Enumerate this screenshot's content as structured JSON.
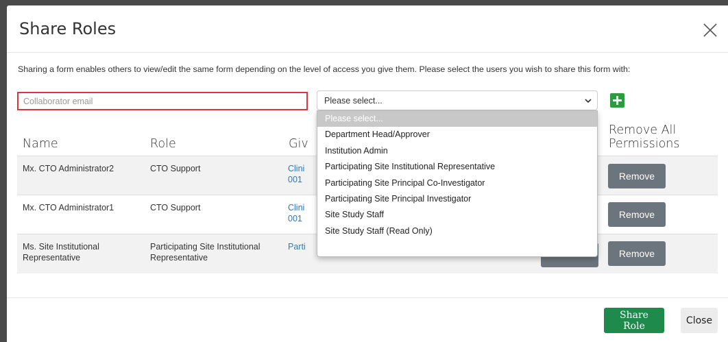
{
  "dialog": {
    "title": "Share Roles",
    "intro": "Sharing a form enables others to view/edit the same form depending on the level of access you give them. Please select the users you wish to share this form with:"
  },
  "form": {
    "email_placeholder": "Collaborator email",
    "select_value": "Please select...",
    "add_icon": "plus-icon"
  },
  "dropdown": {
    "options": [
      "Please select...",
      "Department Head/Approver",
      "Institution Admin",
      "Participating Site Institutional Representative",
      "Participating Site Principal Co-Investigator",
      "Participating Site Principal Investigator",
      "Site Study Staff",
      "Site Study Staff (Read Only)"
    ]
  },
  "table": {
    "headers": {
      "name": "Name",
      "role": "Role",
      "given_partial": "Giv",
      "remove_all_line1": "Remove All",
      "remove_all_line2": "Permissions"
    },
    "rows": [
      {
        "name": "Mx. CTO Administrator2",
        "role": "CTO Support",
        "given_line1": "Clini",
        "given_line2": "001",
        "action": "Remove"
      },
      {
        "name": "Mx. CTO Administrator1",
        "role": "CTO Support",
        "given_line1": "Clini",
        "given_line2": "001",
        "action": "Remove"
      },
      {
        "name_line1": "Ms. Site Institutional",
        "name_line2": "Representative",
        "role_line1": "Participating Site Institutional",
        "role_line2": "Representative",
        "given_line1": "Parti",
        "action": "Remove"
      }
    ]
  },
  "footer": {
    "share_label": "Share Role",
    "close_label": "Close"
  },
  "colors": {
    "highlight_border": "#d9363e",
    "link": "#2a7ac0",
    "add_green": "#2e9b3e",
    "share_green": "#1e8a4c",
    "remove_gray": "#6c757d"
  }
}
